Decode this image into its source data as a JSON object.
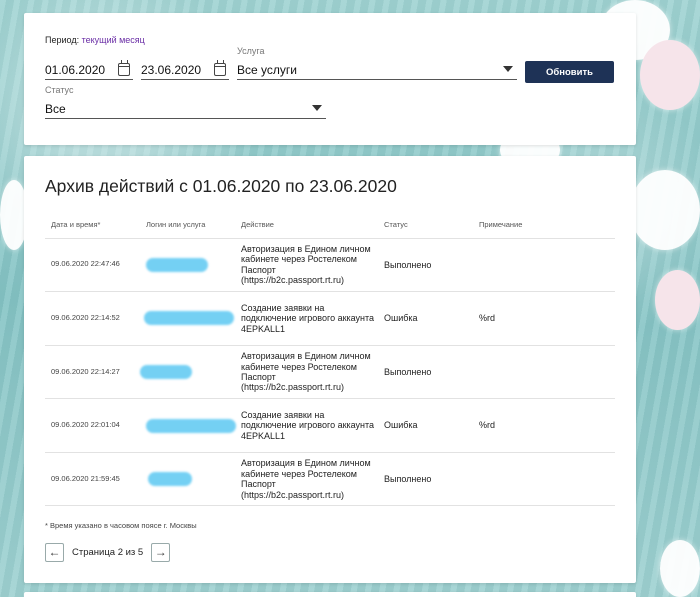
{
  "filters": {
    "period_label": "Период:",
    "period_value": "текущий месяц",
    "date_from": "01.06.2020",
    "date_to": "23.06.2020",
    "service_label": "Услуга",
    "service_value": "Все услуги",
    "status_label": "Статус",
    "status_value": "Все",
    "refresh_button": "Обновить"
  },
  "archive": {
    "title": "Архив действий с 01.06.2020 по 23.06.2020",
    "columns": [
      "Дата и время*",
      "Логин или услуга",
      "Действие",
      "Статус",
      "Примечание"
    ],
    "rows": [
      {
        "datetime": "09.06.2020 22:47:46",
        "login": "",
        "action": "Авторизация в Едином личном кабинете через Ростелеком Паспорт (https://b2c.passport.rt.ru)",
        "status": "Выполнено",
        "note": ""
      },
      {
        "datetime": "09.06.2020 22:14:52",
        "login": "",
        "action": "Создание заявки на подключение игрового аккаунта 4EPKALL1",
        "status": "Ошибка",
        "note": "%rd"
      },
      {
        "datetime": "09.06.2020 22:14:27",
        "login": "",
        "action": "Авторизация в Едином личном кабинете через Ростелеком Паспорт (https://b2c.passport.rt.ru)",
        "status": "Выполнено",
        "note": ""
      },
      {
        "datetime": "09.06.2020 22:01:04",
        "login": "",
        "action": "Создание заявки на подключение игрового аккаунта 4EPKALL1",
        "status": "Ошибка",
        "note": "%rd"
      },
      {
        "datetime": "09.06.2020 21:59:45",
        "login": "",
        "action": "Авторизация в Едином личном кабинете через Ростелеком Паспорт (https://b2c.passport.rt.ru)",
        "status": "Выполнено",
        "note": ""
      }
    ],
    "footnote": "* Время указано в часовом поясе г. Москвы",
    "pagination": {
      "text": "Страница 2 из 5",
      "prev_icon": "arrow-left-icon",
      "next_icon": "arrow-right-icon"
    }
  },
  "colors": {
    "accent_button": "#1e3256",
    "link": "#6b2fa6",
    "redaction": "#5cc8f2"
  }
}
